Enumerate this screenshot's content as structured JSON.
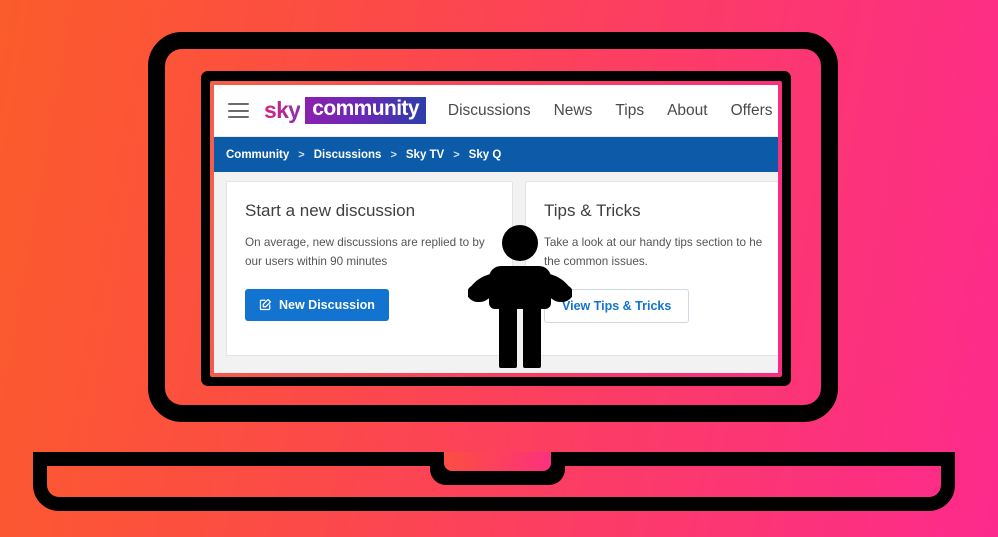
{
  "background": {
    "gradient_from": "#FB5C2B",
    "gradient_to": "#FD2A8D"
  },
  "device": {
    "type": "laptop-illustration",
    "frame_color": "#000000",
    "screen_border_color": "#F4604A"
  },
  "overlay": {
    "figure": "person-shrug-icon",
    "color": "#000000"
  },
  "site": {
    "header": {
      "menu_icon": "hamburger-icon",
      "logo": {
        "word_one": "sky",
        "word_two": "community",
        "badge_gradient_from": "#8B21AE",
        "badge_gradient_to": "#2B3FA8"
      },
      "nav": [
        {
          "label": "Discussions"
        },
        {
          "label": "News"
        },
        {
          "label": "Tips"
        },
        {
          "label": "About"
        },
        {
          "label": "Offers"
        }
      ]
    },
    "breadcrumb": {
      "bar_color": "#0C5BA8",
      "separator": ">",
      "items": [
        {
          "label": "Community"
        },
        {
          "label": "Discussions"
        },
        {
          "label": "Sky TV"
        },
        {
          "label": "Sky Q"
        }
      ]
    },
    "cards": [
      {
        "title": "Start a new discussion",
        "body_line_1": "On average, new discussions are replied to by",
        "body_line_2": "our users within 90 minutes",
        "button_label": "New Discussion",
        "button_icon": "compose-icon",
        "button_style": "primary",
        "accent": "#1273D1"
      },
      {
        "title": "Tips & Tricks",
        "body_line_1": "Take a look at our handy tips section to he",
        "body_line_2": "the common issues.",
        "button_label": "View Tips & Tricks",
        "button_style": "outline",
        "accent": "#1273D1"
      }
    ]
  }
}
